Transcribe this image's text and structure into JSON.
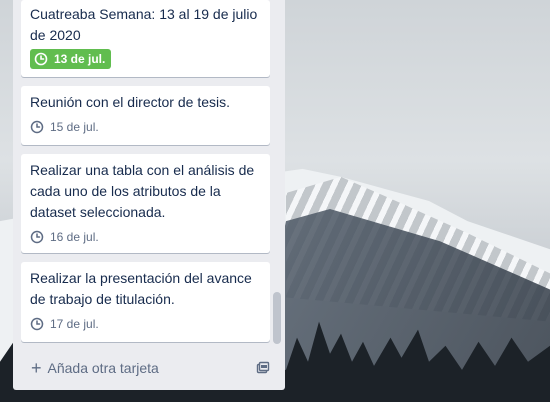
{
  "list": {
    "cards": [
      {
        "title": "Cuatreaba Semana: 13 al 19 de julio de 2020",
        "due": "13 de jul.",
        "due_status": "complete",
        "due_color": "#61bd4f"
      },
      {
        "title": "Reunión con el director de tesis.",
        "due": "15 de jul.",
        "due_status": "normal"
      },
      {
        "title": "Realizar una tabla con el análisis de cada uno de los atributos de la dataset seleccionada.",
        "due": "16 de jul.",
        "due_status": "normal"
      },
      {
        "title": "Realizar la presentación del avance de trabajo de titulación.",
        "due": "17 de jul.",
        "due_status": "normal"
      }
    ],
    "add_card_label": "Añada otra tarjeta",
    "add_card_icon": "plus-icon",
    "template_icon": "card-template-icon"
  },
  "colors": {
    "list_bg": "#ebecf0",
    "card_text": "#172b4d",
    "meta_text": "#5e6c84",
    "due_complete": "#61bd4f"
  }
}
